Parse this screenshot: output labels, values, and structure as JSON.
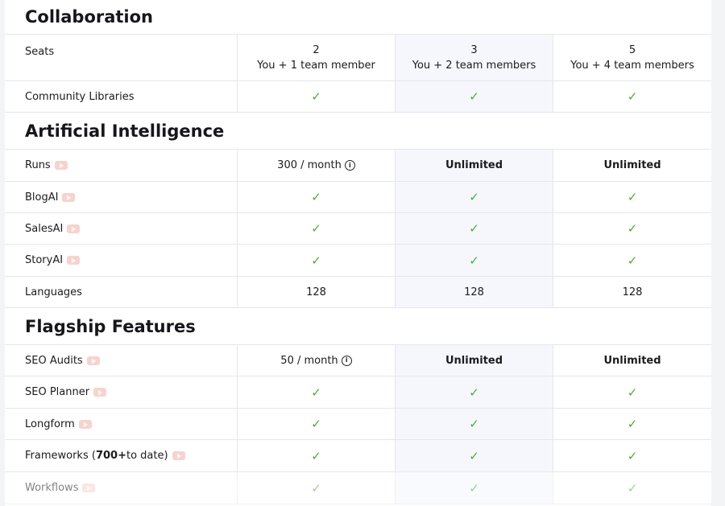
{
  "sections": [
    {
      "title": "Collaboration"
    },
    {
      "title": "Artificial Intelligence"
    },
    {
      "title": "Flagship Features"
    }
  ],
  "rows": {
    "seats": {
      "label": "Seats",
      "plans": [
        [
          "2",
          "You + 1 team member"
        ],
        [
          "3",
          "You + 2 team members"
        ],
        [
          "5",
          "You + 4 team members"
        ]
      ]
    },
    "community_libraries": {
      "label": "Community Libraries"
    },
    "runs": {
      "label": "Runs",
      "values": [
        "300 / month",
        "Unlimited",
        "Unlimited"
      ]
    },
    "blogai": {
      "label": "BlogAI"
    },
    "salesai": {
      "label": "SalesAI"
    },
    "storyai": {
      "label": "StoryAI"
    },
    "languages": {
      "label": "Languages",
      "values": [
        "128",
        "128",
        "128"
      ]
    },
    "seo_audits": {
      "label": "SEO Audits",
      "values": [
        "50 / month",
        "Unlimited",
        "Unlimited"
      ]
    },
    "seo_planner": {
      "label": "SEO Planner"
    },
    "longform": {
      "label": "Longform"
    },
    "frameworks": {
      "label": "Frameworks (",
      "bold": "700+",
      "suffix": " to date)"
    },
    "workflows": {
      "label": "Workflows"
    }
  },
  "glyphs": {
    "check": "✓",
    "info": "i"
  },
  "colors": {
    "check": "#4caf2f",
    "highlight_column": "#f5f7fd",
    "video_badge": "#f9d2cd"
  }
}
